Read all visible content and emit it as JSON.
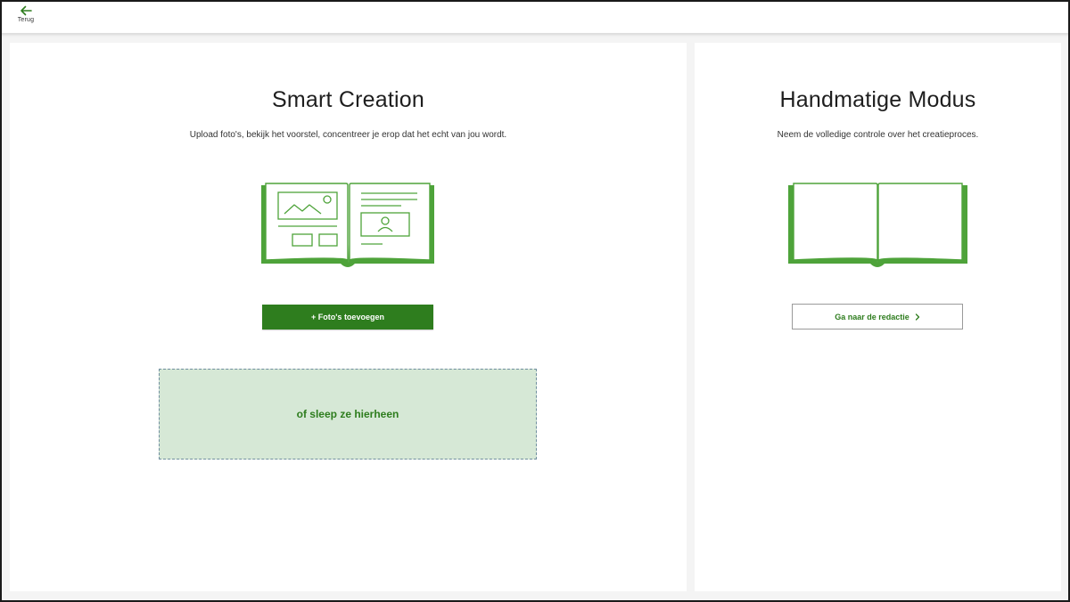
{
  "topbar": {
    "back_label": "Terug",
    "back_icon": "arrow-left-icon"
  },
  "smart_creation": {
    "title": "Smart Creation",
    "subtitle": "Upload foto's, bekijk het voorstel, concentreer je erop dat het echt van jou wordt.",
    "illustration_icon": "photobook-layout-icon",
    "add_button_label": "+ Foto's toevoegen",
    "dropzone_label": "of sleep ze hierheen"
  },
  "manual_mode": {
    "title": "Handmatige Modus",
    "subtitle": "Neem de volledige controle over het creatieproces.",
    "illustration_icon": "open-book-icon",
    "editor_button_label": "Ga naar de redactie",
    "editor_button_icon": "chevron-right-icon"
  },
  "colors": {
    "brand_green": "#2e7d1e",
    "illustration_green": "#4ea33a",
    "dropzone_bg": "#d6e8d6"
  }
}
